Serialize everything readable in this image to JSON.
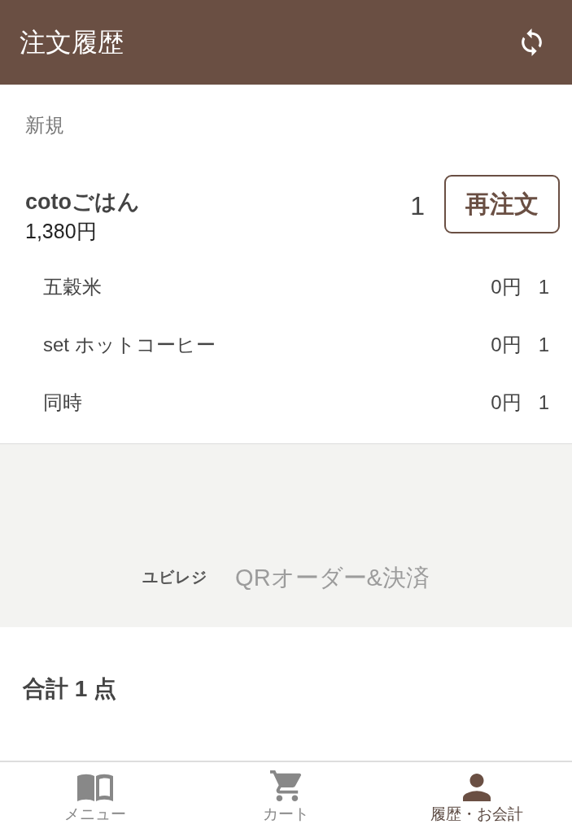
{
  "header": {
    "title": "注文履歴"
  },
  "section": {
    "label": "新規"
  },
  "orders": [
    {
      "name": "cotoごはん",
      "price": "1,380円",
      "quantity": "1",
      "action": "再注文",
      "options": [
        {
          "name": "五穀米",
          "price": "0円",
          "quantity": "1"
        },
        {
          "name": "set ホットコーヒー",
          "price": "0円",
          "quantity": "1"
        },
        {
          "name": "同時",
          "price": "0円",
          "quantity": "1"
        }
      ]
    }
  ],
  "banner": {
    "brand": "ユビレジ",
    "product": "QRオーダー&決済"
  },
  "summary": {
    "total": "合計 1 点"
  },
  "tab_bar": [
    {
      "kind": "menu",
      "label": "メニュー",
      "selected": false
    },
    {
      "kind": "cart",
      "label": "カート",
      "selected": false
    },
    {
      "kind": "account",
      "label": "履歴・お会計",
      "selected": true
    }
  ]
}
